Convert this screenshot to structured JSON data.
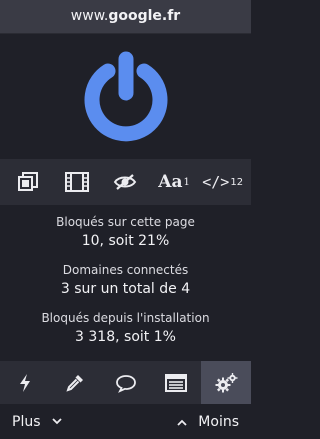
{
  "header": {
    "hostname_prefix": "www.",
    "hostname_domain": "google.fr"
  },
  "power": {
    "icon": "power-icon",
    "color": "#5b8def",
    "state": "on"
  },
  "tools": [
    {
      "icon": "no-popups-icon"
    },
    {
      "icon": "no-large-media-icon"
    },
    {
      "icon": "no-cosmetic-filtering-icon"
    },
    {
      "icon": "no-remote-fonts-icon",
      "label": "Aa",
      "badge": "1"
    },
    {
      "icon": "no-scripting-icon",
      "label": "</>",
      "badge": "12"
    }
  ],
  "stats": {
    "blocked_page_label": "Bloqués sur cette page",
    "blocked_page_value": "10, soit 21%",
    "domains_label": "Domaines connectés",
    "domains_value": "3 sur un total de 4",
    "blocked_total_label": "Bloqués depuis l'installation",
    "blocked_total_value": "3 318, soit 1%"
  },
  "bottom_tools": [
    {
      "icon": "lightning-icon"
    },
    {
      "icon": "eyedropper-icon"
    },
    {
      "icon": "speech-bubble-icon"
    },
    {
      "icon": "logger-list-icon"
    },
    {
      "icon": "gears-icon",
      "active": true
    }
  ],
  "footer": {
    "more_label": "Plus",
    "less_label": "Moins"
  },
  "colors": {
    "background": "#1f2028",
    "toolbar": "#2c2d36",
    "header": "#3a3b45",
    "active_tool": "#4a4c5a",
    "accent": "#5b8def"
  }
}
